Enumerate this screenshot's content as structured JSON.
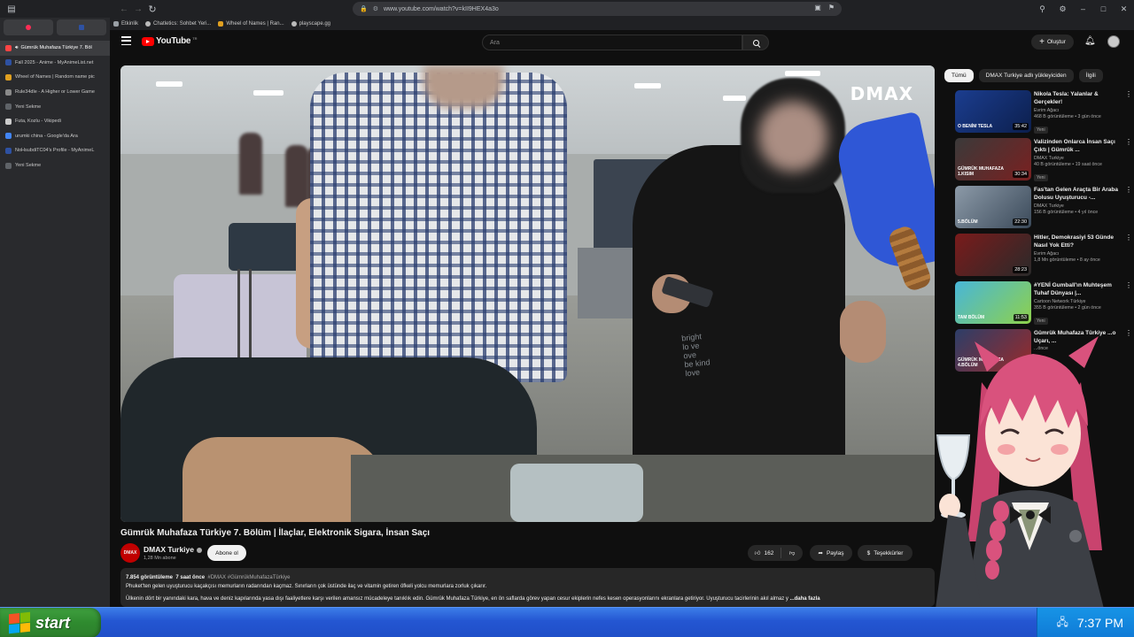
{
  "browser": {
    "url": "www.youtube.com/watch?v=kII9HEX4a3o",
    "bookmarks": [
      "Etkinlik",
      "Chatletics: Sohbet Yeri...",
      "Wheel of Names | Ran...",
      "playscape.gg"
    ],
    "tabs": [
      {
        "label": "Gümrük Muhafaza Türkiye 7. Böl",
        "color": "#ff4444"
      },
      {
        "label": "Fall 2025 - Anime - MyAnimeList.net",
        "color": "#2e51a2"
      },
      {
        "label": "Wheel of Names | Random name pic",
        "color": "#e0a020"
      },
      {
        "label": "Rule34dle - A Higher or Lower Game",
        "color": "#8a8a8a"
      },
      {
        "label": "Yeni Sekme",
        "color": "#5f6368"
      },
      {
        "label": "Futa, Kozlu - Vikipedi",
        "color": "#cccccc"
      },
      {
        "label": "urumki china - Google'da Ara",
        "color": "#4285f4"
      },
      {
        "label": "NoHsubdiTC04's Profile - MyAnimeL",
        "color": "#2e51a2"
      },
      {
        "label": "Yeni Sekme",
        "color": "#5f6368"
      }
    ]
  },
  "youtube": {
    "logo": "YouTube",
    "logo_region": "TR",
    "search_placeholder": "Ara",
    "create_label": "Oluştur",
    "video": {
      "watermark": "DMAX",
      "title": "Gümrük Muhafaza Türkiye 7. Bölüm | İlaçlar, Elektronik Sigara, İnsan Saçı",
      "channel": "DMAX Turkiye",
      "channel_avatar_text": "DMAX",
      "subscribers": "1,28 Mn abone",
      "subscribe_label": "Abone ol",
      "likes": "162",
      "share_label": "Paylaş",
      "thanks_label": "Teşekkürler",
      "views": "7.854 görüntüleme",
      "age": "7 saat önce",
      "tags": "#DMAX #GümrükMuhafazaTürkiye",
      "desc_line1": "Phuket'ten gelen uyuşturucu kaçakçısı memurların radarından kaçmaz. Sınırların çok üstünde ilaç ve vitamin getiren öfkeli yolcu memurlara zorluk çıkarır.",
      "desc_line2": "Ülkenin dört bir yanındaki kara, hava ve deniz kapılarında yasa dışı faaliyetlere karşı verilen amansız mücadeleye tanıklık edin. Gümrük Muhafaza Türkiye, en ön saflarda görev yapan cesur ekiplerin nefes kesen operasyonlarını ekranlara getiriyor. Uyuşturucu tacirlerinin akıl almaz y",
      "show_more": "...daha fazla"
    },
    "chips": [
      "Tümü",
      "DMAX Turkiye adlı yükleyiciden",
      "İlgili"
    ],
    "recommendations": [
      {
        "title": "Nikola Tesla: Yalanlar & Gerçekler!",
        "channel": "Evrim Ağacı",
        "meta": "468 B görüntüleme • 3 gün önce",
        "badge": "Yeni",
        "duration": "35:42",
        "thumb_text": "O BENİM TESLA"
      },
      {
        "title": "Valizinden Onlarca İnsan Saçı Çıktı | Gümrük ...",
        "channel": "DMAX Turkiye",
        "meta": "40 B görüntüleme • 19 saat önce",
        "badge": "Yeni",
        "duration": "30:34",
        "thumb_text": "GÜMRÜK MUHAFAZA 1.KISIM"
      },
      {
        "title": "Fas'tan Gelen Araçta Bir Araba Dolusu Uyuşturucu -...",
        "channel": "DMAX Turkiye",
        "meta": "156 B görüntüleme • 4 yıl önce",
        "badge": "",
        "duration": "22:30",
        "thumb_text": "5.BÖLÜM"
      },
      {
        "title": "Hitler, Demokrasiyi 53 Günde Nasıl Yok Etti?",
        "channel": "Evrim Ağacı",
        "meta": "1,8 Mn görüntüleme • 8 ay önce",
        "badge": "",
        "duration": "28:23",
        "thumb_text": ""
      },
      {
        "title": "#YENİ Gumball'ın Muhteşem Tuhaf Dünyası |...",
        "channel": "Cartoon Network Türkiye",
        "meta": "355 B görüntüleme • 2 gün önce",
        "badge": "Yeni",
        "duration": "11:53",
        "thumb_text": "TAM BÖLÜM"
      },
      {
        "title": "Gümrük Muhafaza Türkiye ...o Uçarı, ...",
        "channel": "",
        "meta": "...önce",
        "badge": "",
        "duration": "",
        "thumb_text": "GÜMRÜK MUHAFAZA 4.BÖLÜM"
      }
    ]
  },
  "taskbar": {
    "start_label": "start",
    "clock": "7:37 PM"
  },
  "colors": {
    "accent_red": "#ff0000",
    "xp_blue": "#2456d2",
    "xp_green": "#2f8a2f"
  }
}
